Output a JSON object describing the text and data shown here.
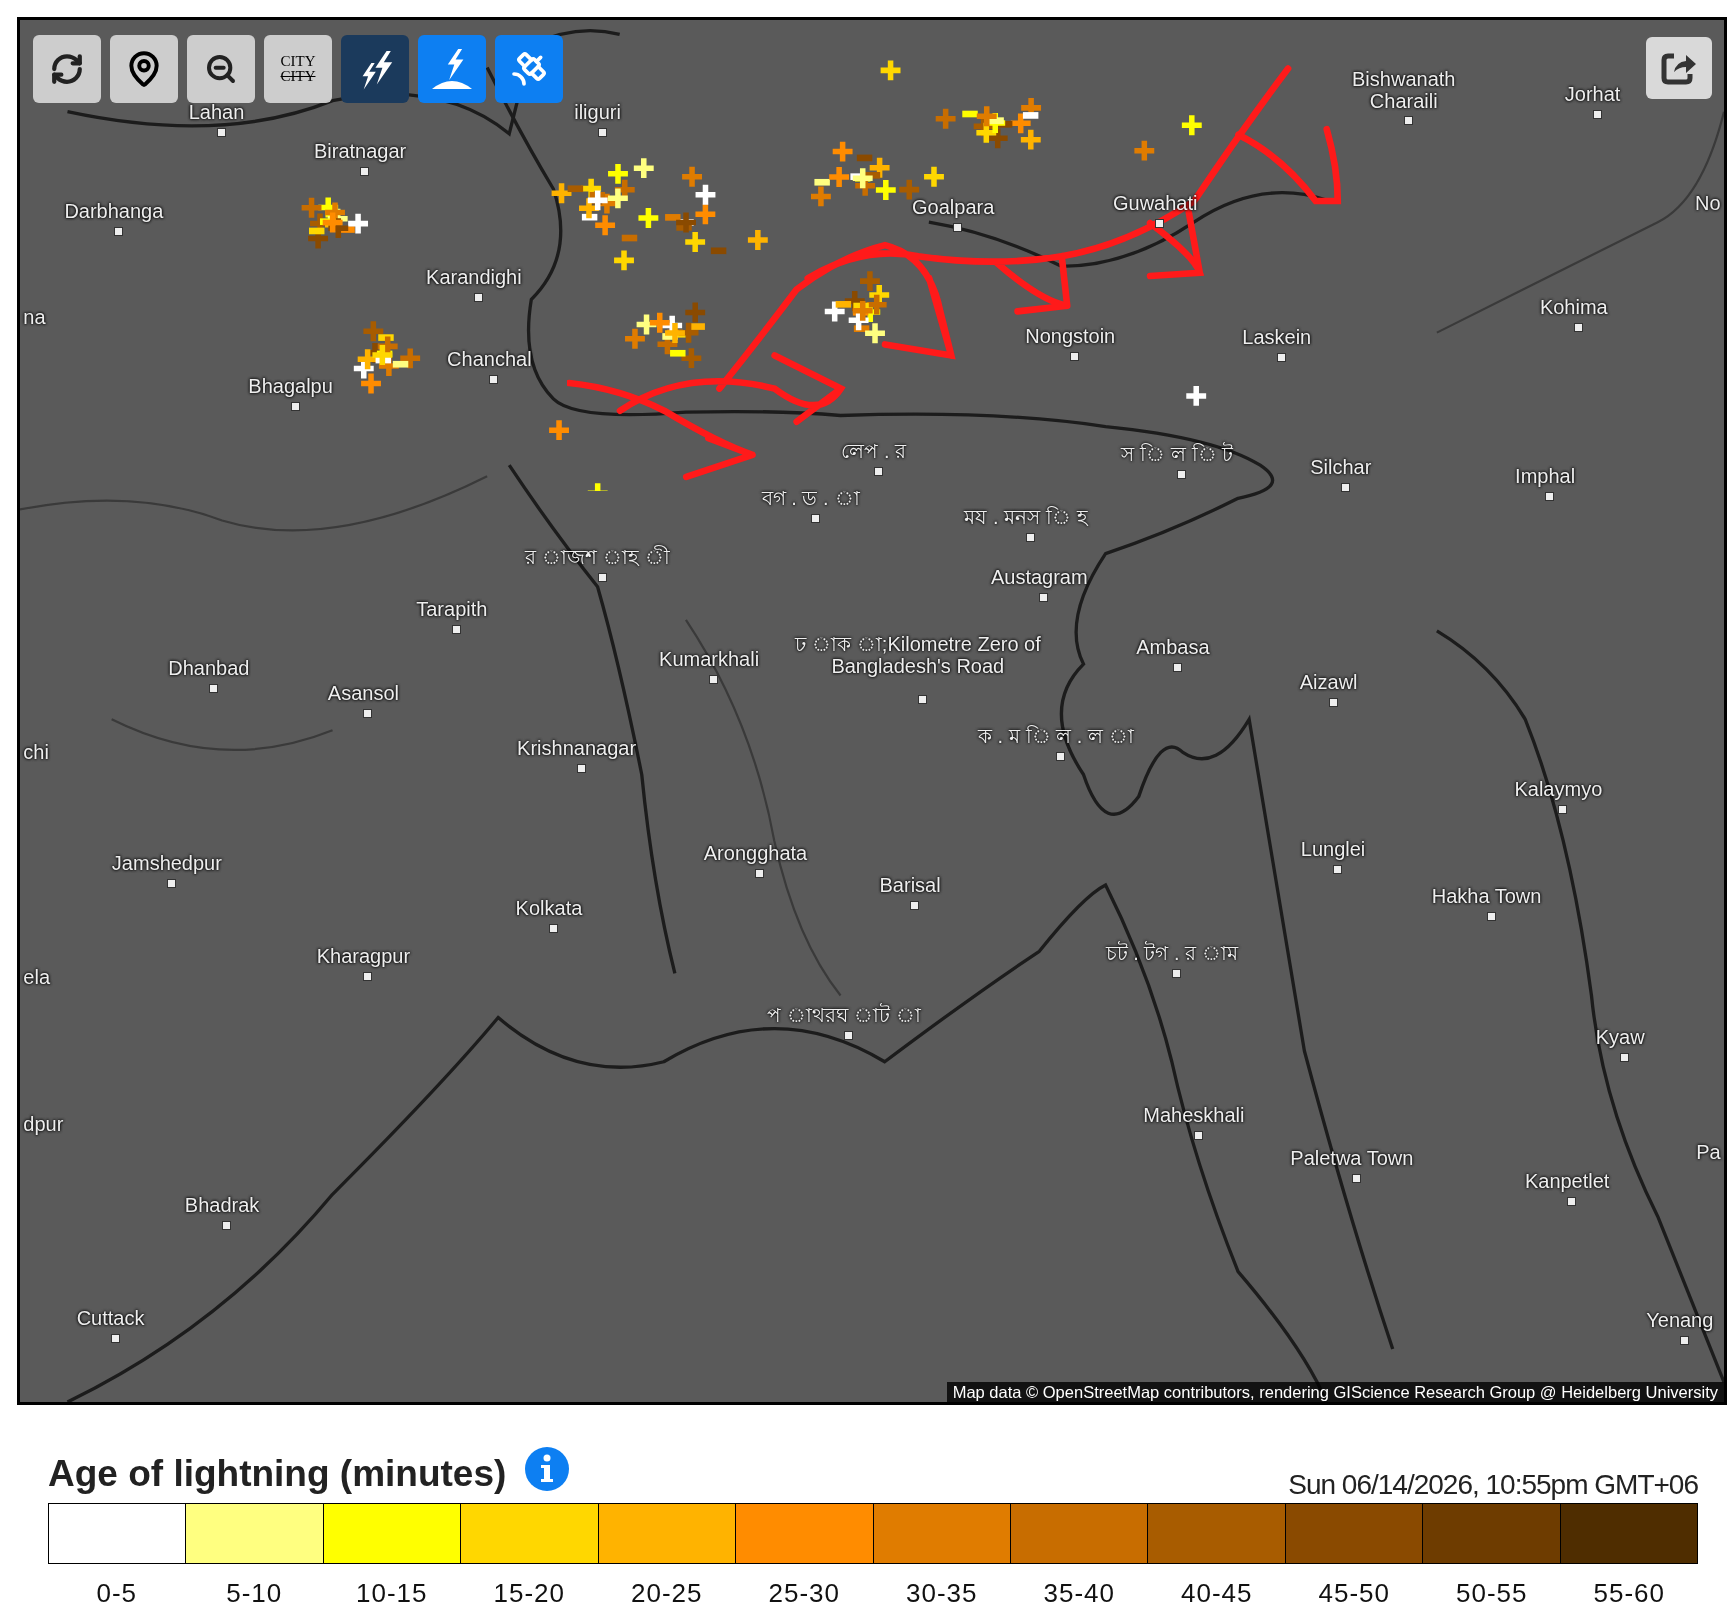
{
  "toolbar": {
    "buttons": [
      {
        "kind": "refresh",
        "on": false
      },
      {
        "kind": "locate",
        "on": false
      },
      {
        "kind": "zoom_out",
        "on": false
      },
      {
        "kind": "city",
        "on": false,
        "label": "CITY",
        "struck_label": "CITY"
      },
      {
        "kind": "lightning",
        "on": false
      },
      {
        "kind": "ground_strike",
        "on": true
      },
      {
        "kind": "satellite",
        "on": true
      }
    ]
  },
  "map": {
    "places": [
      {
        "name": "Lahan"
      },
      {
        "name": "iliguri"
      },
      {
        "name": "Biratnagar"
      },
      {
        "name": "Darbhanga"
      },
      {
        "name": "Karandighi"
      },
      {
        "name": "na"
      },
      {
        "name": "Chanchal"
      },
      {
        "name": "Bhagalpu"
      },
      {
        "name": "Tarapith"
      },
      {
        "name": "Dhanbad"
      },
      {
        "name": "Asansol"
      },
      {
        "name": "chi"
      },
      {
        "name": "Krishnanagar"
      },
      {
        "name": "Kumarkhali"
      },
      {
        "name": "Jamshedpur"
      },
      {
        "name": "Kolkata"
      },
      {
        "name": "Kharagpur"
      },
      {
        "name": "ela"
      },
      {
        "name": "dpur"
      },
      {
        "name": "Bhadrak"
      },
      {
        "name": "Cuttack"
      },
      {
        "name": "Arongghata"
      },
      {
        "name": "Barisal"
      },
      {
        "name": "Goalpara"
      },
      {
        "name": "Guwahati"
      },
      {
        "name": "Nongstoin"
      },
      {
        "name": "Laskein"
      },
      {
        "name": "Bishwanath Charaili"
      },
      {
        "name": "Jorhat"
      },
      {
        "name": "No"
      },
      {
        "name": "Kohima"
      },
      {
        "name": "Silchar"
      },
      {
        "name": "Imphal"
      },
      {
        "name": "Austagram"
      },
      {
        "name": "Ambasa"
      },
      {
        "name": "Aizawl"
      },
      {
        "name": "Kalaymyo"
      },
      {
        "name": "Lunglei"
      },
      {
        "name": "Hakha Town"
      },
      {
        "name": "Kyaw"
      },
      {
        "name": "Maheskhali"
      },
      {
        "name": "Paletwa Town"
      },
      {
        "name": "Kanpetlet"
      },
      {
        "name": "Pa"
      },
      {
        "name": "Yenang"
      },
      {
        "name": "ঢ াক া;Kilometre Zero of Bangladesh's Road"
      },
      {
        "name": "স ি ল ি ট"
      },
      {
        "name": "ময . মনস ি হ"
      },
      {
        "name": "বগ . ড . া"
      },
      {
        "name": "লেপ . র"
      },
      {
        "name": "র াজশ াহ ী"
      },
      {
        "name": "ক . ম ি ল . ল া"
      },
      {
        "name": "চট . টগ . র াম"
      },
      {
        "name": "প াথরঘ াট া"
      }
    ],
    "attribution": "Map data © OpenStreetMap contributors, rendering GIScience Research Group @ Heidelberg University"
  },
  "legend": {
    "title": "Age of lightning (minutes)",
    "timestamp": "Sun 06/14/2026, 10:55pm GMT+06",
    "scale": [
      {
        "label": "0-5",
        "color": "#ffffff"
      },
      {
        "label": "5-10",
        "color": "#ffff80"
      },
      {
        "label": "10-15",
        "color": "#ffff00"
      },
      {
        "label": "15-20",
        "color": "#ffd700"
      },
      {
        "label": "20-25",
        "color": "#ffb300"
      },
      {
        "label": "25-30",
        "color": "#ff8c00"
      },
      {
        "label": "30-35",
        "color": "#e07c00"
      },
      {
        "label": "35-40",
        "color": "#c86d00"
      },
      {
        "label": "40-45",
        "color": "#a85c00"
      },
      {
        "label": "45-50",
        "color": "#8a4a00"
      },
      {
        "label": "50-55",
        "color": "#6e3c00"
      },
      {
        "label": "55-60",
        "color": "#4f2d00"
      }
    ]
  }
}
